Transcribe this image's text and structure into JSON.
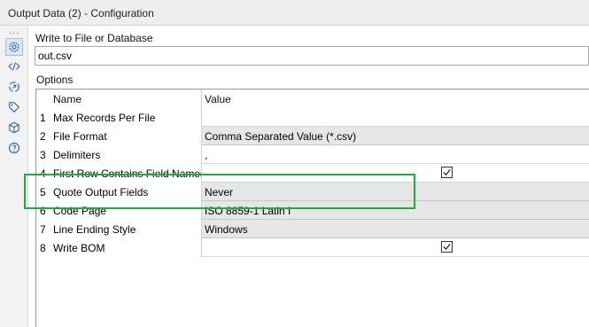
{
  "window": {
    "title": "Output Data (2) - Configuration"
  },
  "sidebar": {
    "overflow": "...",
    "icons": [
      "gear-icon",
      "code-icon",
      "connection-icon",
      "tag-icon",
      "cube-icon",
      "help-icon"
    ]
  },
  "write_to": {
    "label": "Write to File or Database",
    "value": "out.csv"
  },
  "options": {
    "label": "Options",
    "headers": {
      "name": "Name",
      "value": "Value"
    },
    "rows": [
      {
        "idx": "1",
        "name": "Max Records Per File",
        "value": "",
        "kind": "text"
      },
      {
        "idx": "2",
        "name": "File Format",
        "value": "Comma Separated Value (*.csv)",
        "kind": "dropdown"
      },
      {
        "idx": "3",
        "name": "Delimiters",
        "value": ",",
        "kind": "text"
      },
      {
        "idx": "4",
        "name": "First Row Contains Field Names",
        "value": "",
        "kind": "checkbox",
        "checked": true
      },
      {
        "idx": "5",
        "name": "Quote Output Fields",
        "value": "Never",
        "kind": "dropdown"
      },
      {
        "idx": "6",
        "name": "Code Page",
        "value": "ISO 8859-1 Latin I",
        "kind": "dropdown"
      },
      {
        "idx": "7",
        "name": "Line Ending Style",
        "value": "Windows",
        "kind": "dropdown"
      },
      {
        "idx": "8",
        "name": "Write BOM",
        "value": "",
        "kind": "checkbox",
        "checked": true
      }
    ]
  },
  "colors": {
    "highlight": "#22a844",
    "dropdown_bg": "#e6e6e6"
  }
}
